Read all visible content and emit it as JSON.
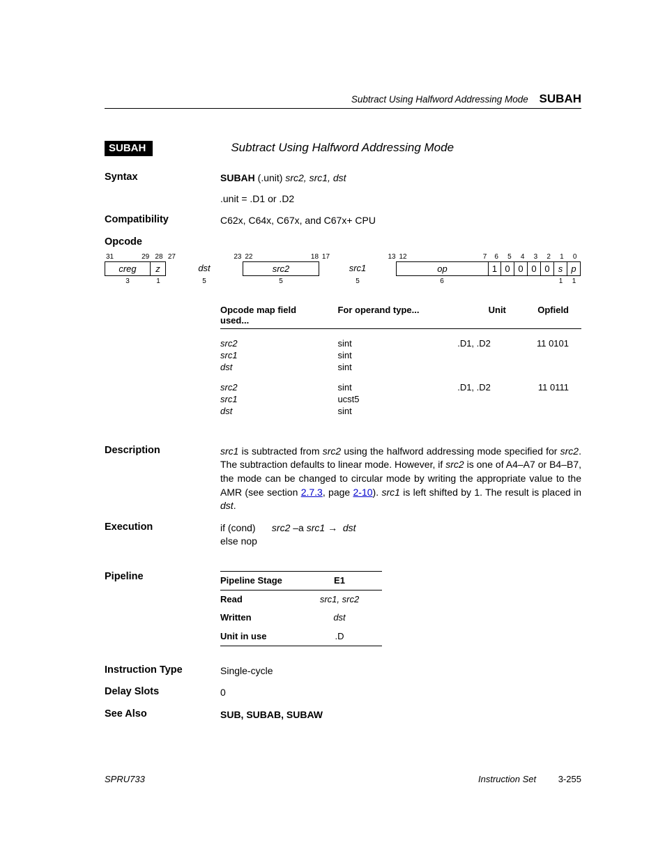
{
  "header": {
    "title": "Subtract Using Halfword Addressing Mode",
    "mnemonic": "SUBAH"
  },
  "chip": "SUBAH",
  "desc_title": "Subtract Using Halfword Addressing Mode",
  "syntax": {
    "label": "Syntax",
    "line_bold": "SUBAH",
    "line_rest": " (.unit) ",
    "line_args": "src2, src1, dst",
    "unit_line": ".unit = .D1 or .D2"
  },
  "compatibility": {
    "label": "Compatibility",
    "text": "C62x, C64x, C67x, and C67x+ CPU"
  },
  "opcode": {
    "label": "Opcode",
    "bitnums": [
      "31",
      "29",
      "28",
      "27",
      "23",
      "22",
      "18",
      "17",
      "13",
      "12",
      "7",
      "6",
      "5",
      "4",
      "3",
      "2",
      "1",
      "0"
    ],
    "fields": {
      "creg": "creg",
      "z": "z",
      "dst": "dst",
      "src2": "src2",
      "src1": "src1",
      "op": "op",
      "b6": "1",
      "b5": "0",
      "b4": "0",
      "b3": "0",
      "b2": "0",
      "s": "s",
      "p": "p"
    },
    "widths": {
      "creg": "3",
      "z": "1",
      "dst": "5",
      "src2": "5",
      "src1": "5",
      "op": "6",
      "s": "1",
      "p": "1"
    }
  },
  "opmap": {
    "head": [
      "Opcode map field used...",
      "For operand type...",
      "Unit",
      "Opfield"
    ],
    "rows": [
      [
        "src2",
        "sint",
        ".D1, .D2",
        "11 0101"
      ],
      [
        "src1",
        "sint",
        "",
        ""
      ],
      [
        "dst",
        "sint",
        "",
        ""
      ]
    ],
    "rows2": [
      [
        "src2",
        "sint",
        ".D1, .D2",
        "11 0111"
      ],
      [
        "src1",
        "ucst5",
        "",
        ""
      ],
      [
        "dst",
        "sint",
        "",
        ""
      ]
    ]
  },
  "description": {
    "label": "Description",
    "p1_a": " is subtracted from ",
    "p1_b": " using the halfword addressing mode specified for ",
    "p1_c": ". The subtraction defaults to linear mode. However, if ",
    "p1_d": " is one of A4–A7 or B4–B7, the mode can be changed to circular mode by writing the appropriate value to the AMR (see section ",
    "link1": "2.7.3",
    "p1_e": ", page ",
    "link2": "2-10",
    "p1_f": "). ",
    "p1_g": " is left shifted by 1. The result is placed in ",
    "src1": "src1",
    "src2": "src2",
    "dst": "dst"
  },
  "execution": {
    "label": "Execution",
    "l1a": "if (cond)",
    "l1b": "src2",
    "l1mid": " –a ",
    "l1c": "src1",
    "arrow": " → ",
    "l1d": "dst",
    "l2": "else nop"
  },
  "pipeline": {
    "label": "Pipeline",
    "hdr1": "Pipeline Stage",
    "hdr2": "E1",
    "r1a": "Read",
    "r1b": "src1, src2",
    "r2a": "Written",
    "r2b": "dst",
    "r3a": "Unit in use",
    "r3b": ".D"
  },
  "instr_type": {
    "label": "Instruction Type",
    "value": "Single-cycle"
  },
  "delay_slots": {
    "label": "Delay Slots",
    "value": "0"
  },
  "see_also": {
    "label": "See Also",
    "value": "SUB, SUBAB, SUBAW"
  },
  "footer": {
    "left": "SPRU733",
    "chapter": "Instruction Set",
    "page": "3-255"
  }
}
